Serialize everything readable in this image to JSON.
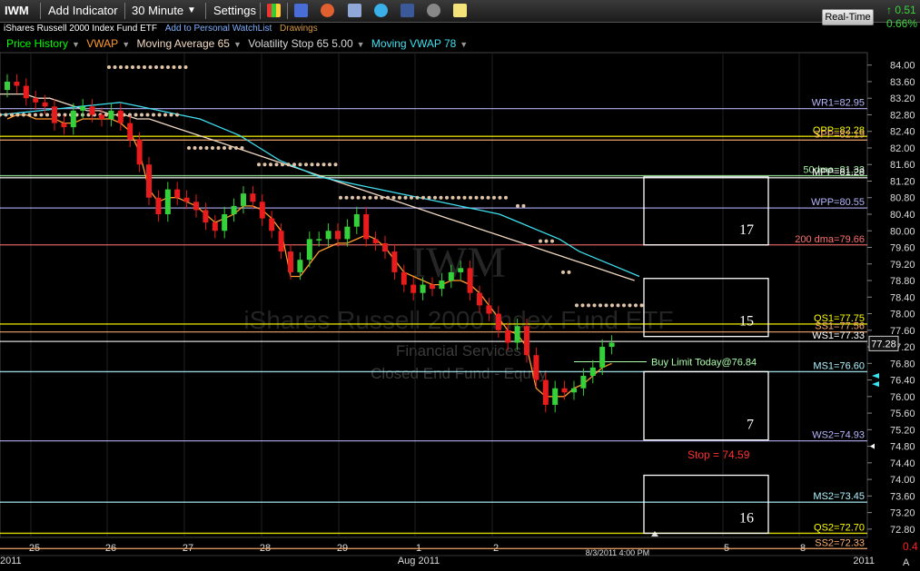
{
  "toolbar": {
    "symbol": "IWM",
    "add_indicator": "Add Indicator",
    "interval": "30 Minute",
    "settings": "Settings",
    "realtime": "Real-Time",
    "change": "0.51",
    "change_pct": "0.66%"
  },
  "header": {
    "fund_name": "iShares Russell 2000 Index Fund ETF",
    "watchlist_link": "Add to Personal WatchList",
    "drawings_link": "Drawings"
  },
  "indicators": [
    {
      "label": "Price History",
      "color": "#00ff00"
    },
    {
      "label": "VWAP",
      "color": "#ff9a2e"
    },
    {
      "label": "Moving Average 65",
      "color": "#f1d9c2"
    },
    {
      "label": "Volatility Stop 65 5.00",
      "color": "#d8d8d8"
    },
    {
      "label": "Moving VWAP 78",
      "color": "#3ee0f0"
    }
  ],
  "watermark": {
    "symbol": "IWM",
    "name": "iShares Russell 2000 Index Fund ETF",
    "sector": "Financial Services",
    "category": "Closed End Fund - Equity"
  },
  "chart_data": {
    "type": "candlestick",
    "ylim": [
      72.6,
      84.3
    ],
    "y_ticks": [
      "84.00",
      "83.60",
      "83.20",
      "82.80",
      "82.40",
      "82.00",
      "81.60",
      "81.20",
      "80.80",
      "80.40",
      "80.00",
      "79.60",
      "79.20",
      "78.80",
      "78.40",
      "78.00",
      "77.60",
      "77.20",
      "76.80",
      "76.40",
      "76.00",
      "75.60",
      "75.20",
      "74.80",
      "74.40",
      "74.00",
      "73.60",
      "73.20",
      "72.80"
    ],
    "x_ticks": [
      "25",
      "26",
      "27",
      "28",
      "29",
      "1",
      "2",
      "5",
      "8"
    ],
    "x_month_labels": [
      "2011",
      "Aug 2011",
      "2011"
    ],
    "current_price": "77.28",
    "last_time_label": "8/3/2011 4:00 PM",
    "bottom_right_value": "0.4",
    "bottom_right_tag": "A",
    "levels": [
      {
        "label": "WR1=82.95",
        "value": 82.95,
        "color": "#b7b7ff"
      },
      {
        "label": "QPP=82.28",
        "value": 82.28,
        "color": "#ffff00"
      },
      {
        "label": "SPP=82.19",
        "value": 82.19,
        "color": "#ffb070"
      },
      {
        "label": "50dma=81.33",
        "value": 81.33,
        "color": "#a0f0a0"
      },
      {
        "label": "MPP=81.28",
        "value": 81.28,
        "color": "#ffffff"
      },
      {
        "label": "WPP=80.55",
        "value": 80.55,
        "color": "#b7b7ff"
      },
      {
        "label": "200 dma=79.66",
        "value": 79.66,
        "color": "#ff7070"
      },
      {
        "label": "QS1=77.75",
        "value": 77.75,
        "color": "#ffff00"
      },
      {
        "label": "SS1=77.56",
        "value": 77.56,
        "color": "#ffb070"
      },
      {
        "label": "WS1=77.33",
        "value": 77.33,
        "color": "#ffffff"
      },
      {
        "label": "MS1=76.60",
        "value": 76.6,
        "color": "#aef4ff"
      },
      {
        "label": "WS2=74.93",
        "value": 74.93,
        "color": "#b7b7ff"
      },
      {
        "label": "MS2=73.45",
        "value": 73.45,
        "color": "#aef4ff"
      },
      {
        "label": "QS2=72.70",
        "value": 72.7,
        "color": "#ffff00"
      },
      {
        "label": "SS2=72.33",
        "value": 72.33,
        "color": "#ffb070"
      }
    ],
    "annotations": [
      {
        "text": "Buy Limit Today@76.84",
        "value": 76.84,
        "color": "#aaffaa"
      },
      {
        "text": "Stop = 74.59",
        "value": 74.59,
        "color": "#ff3030"
      }
    ],
    "boxes": [
      {
        "label": "17",
        "top": 81.3,
        "bottom": 79.66
      },
      {
        "label": "15",
        "top": 78.85,
        "bottom": 77.45
      },
      {
        "label": "7",
        "top": 76.6,
        "bottom": 74.95
      },
      {
        "label": "16",
        "top": 74.1,
        "bottom": 72.7
      }
    ],
    "series": [
      {
        "name": "Price History",
        "open": [
          83.4,
          83.6,
          83.5,
          83.2,
          83.1,
          83.0,
          82.6,
          82.5,
          82.9,
          83.0,
          82.8,
          82.7,
          82.9,
          82.6,
          82.2,
          81.6,
          80.8,
          80.4,
          81.0,
          80.8,
          80.7,
          80.5,
          80.2,
          80.0,
          80.4,
          80.6,
          80.9,
          80.7,
          80.3,
          80.0,
          79.5,
          79.0,
          79.3,
          79.8,
          79.8,
          80.0,
          79.8,
          80.1,
          80.4,
          79.8,
          79.7,
          79.5,
          79.0,
          78.7,
          78.5,
          78.7,
          78.6,
          78.8,
          79.0,
          79.1,
          78.5,
          78.2,
          78.0,
          77.6,
          77.3,
          77.7,
          77.0,
          76.4,
          75.8,
          76.2,
          76.1,
          76.2,
          76.5,
          76.7,
          77.2
        ],
        "close": [
          83.6,
          83.5,
          83.2,
          83.1,
          83.0,
          82.6,
          82.5,
          82.9,
          83.0,
          82.8,
          82.7,
          82.9,
          82.6,
          82.2,
          81.6,
          80.8,
          80.4,
          81.0,
          80.8,
          80.7,
          80.5,
          80.2,
          80.0,
          80.4,
          80.6,
          80.9,
          80.7,
          80.3,
          80.0,
          79.5,
          79.0,
          79.3,
          79.8,
          79.8,
          80.0,
          79.8,
          80.1,
          80.4,
          79.8,
          79.7,
          79.5,
          79.0,
          78.7,
          78.5,
          78.7,
          78.6,
          78.8,
          79.0,
          79.1,
          78.5,
          78.2,
          78.0,
          77.6,
          77.3,
          77.7,
          77.0,
          76.4,
          75.8,
          76.2,
          76.1,
          76.2,
          76.5,
          76.7,
          77.2,
          77.3
        ]
      },
      {
        "name": "VWAP",
        "values": [
          82.7,
          82.8,
          82.8,
          82.7,
          82.7,
          82.7,
          82.6,
          82.6,
          82.7,
          82.7,
          82.7,
          82.7,
          82.6,
          82.4,
          81.9,
          81.0,
          80.7,
          80.8,
          80.8,
          80.7,
          80.6,
          80.4,
          80.2,
          80.3,
          80.4,
          80.6,
          80.6,
          80.5,
          80.3,
          80.0,
          78.9,
          78.9,
          79.2,
          79.5,
          79.6,
          79.7,
          79.7,
          79.8,
          79.9,
          79.8,
          79.6,
          79.3,
          79.0,
          78.9,
          78.8,
          78.7,
          78.7,
          78.8,
          78.8,
          78.7,
          78.5,
          78.2,
          77.9,
          77.6,
          77.5,
          77.2,
          76.2,
          76.0,
          76.0,
          76.0,
          76.2,
          76.3,
          76.5,
          76.7,
          76.8
        ]
      },
      {
        "name": "Moving Average 65",
        "values": [
          83.3,
          83.3,
          83.3,
          83.2,
          83.2,
          83.1,
          83.0,
          82.9,
          82.9,
          82.8,
          82.8,
          82.7,
          82.7,
          82.6,
          82.5,
          82.4,
          82.3,
          82.2,
          82.1,
          82.0,
          81.9,
          81.8,
          81.7,
          81.6,
          81.5,
          81.4,
          81.3,
          81.2,
          81.1,
          81.0,
          80.9,
          80.8,
          80.7,
          80.6,
          80.5,
          80.4,
          80.3,
          80.2,
          80.1,
          80.0,
          79.9,
          79.8,
          79.7,
          79.6,
          79.5,
          79.4,
          79.3,
          79.2,
          79.1,
          79.0,
          78.9,
          78.8
        ]
      },
      {
        "name": "Moving VWAP 78",
        "values": [
          82.8,
          82.85,
          82.9,
          82.95,
          83.0,
          83.05,
          83.1,
          83.0,
          82.9,
          82.8,
          82.7,
          82.5,
          82.3,
          82.0,
          81.7,
          81.5,
          81.3,
          81.2,
          81.1,
          81.0,
          80.9,
          80.8,
          80.7,
          80.6,
          80.5,
          80.4,
          80.2,
          80.0,
          79.8,
          79.5,
          79.3,
          79.1,
          78.9
        ]
      }
    ]
  }
}
